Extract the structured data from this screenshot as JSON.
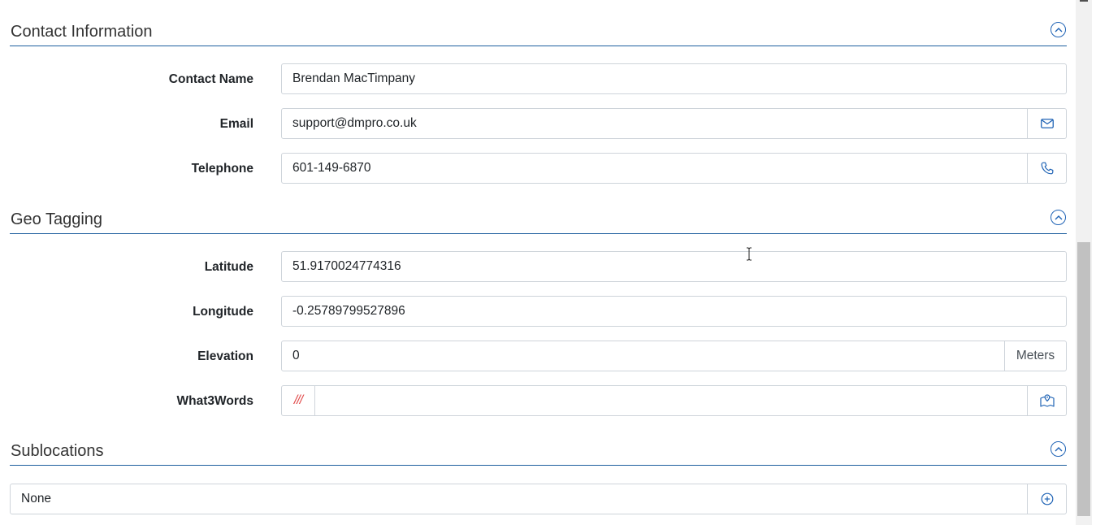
{
  "contact": {
    "title": "Contact Information",
    "name_label": "Contact Name",
    "name_value": "Brendan MacTimpany",
    "email_label": "Email",
    "email_value": "support@dmpro.co.uk",
    "phone_label": "Telephone",
    "phone_value": "601-149-6870"
  },
  "geo": {
    "title": "Geo Tagging",
    "lat_label": "Latitude",
    "lat_value": "51.9170024774316",
    "lon_label": "Longitude",
    "lon_value": "-0.25789799527896",
    "elev_label": "Elevation",
    "elev_value": "0",
    "elev_unit": "Meters",
    "w3w_label": "What3Words",
    "w3w_prefix": "///",
    "w3w_value": ""
  },
  "sublocations": {
    "title": "Sublocations",
    "value": "None"
  },
  "icons": {
    "collapse": "chevron-up-circle-icon",
    "email": "envelope-icon",
    "phone": "phone-icon",
    "map": "map-icon",
    "add": "plus-circle-icon"
  },
  "colors": {
    "accent": "#1f63b5",
    "section_rule": "#1d5f9e",
    "w3w_red": "#e14b4b"
  }
}
